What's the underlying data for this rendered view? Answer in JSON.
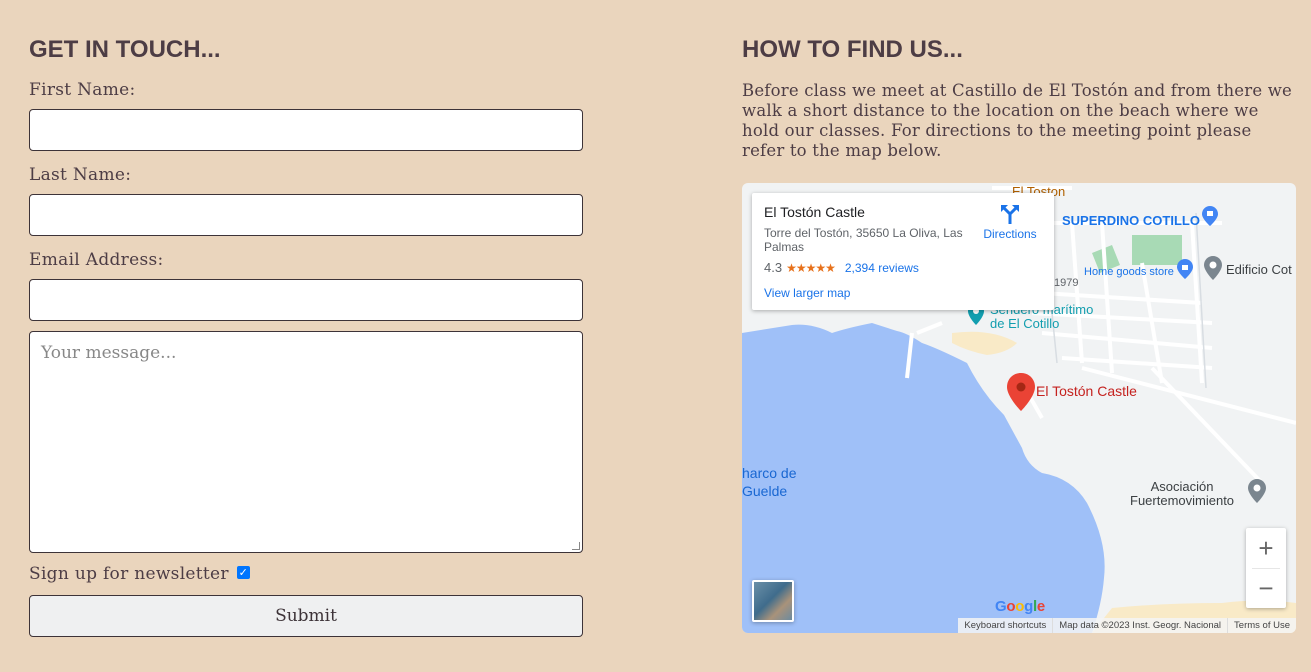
{
  "contact": {
    "heading": "GET IN TOUCH...",
    "first_name_label": "First Name:",
    "last_name_label": "Last Name:",
    "email_label": "Email Address:",
    "message_placeholder": "Your message...",
    "newsletter_label": "Sign up for newsletter",
    "newsletter_checked": true,
    "submit_label": "Submit"
  },
  "find_us": {
    "heading": "HOW TO FIND US...",
    "description": "Before class we meet at Castillo de El Tostón and from there we walk a short distance to the location on the beach where we hold our classes. For directions to the meeting point please refer to the map below."
  },
  "map": {
    "place_name": "El Tostón Castle",
    "address": "Torre del Tostón, 35650 La Oliva, Las Palmas",
    "rating": "4.3",
    "stars": "★★★★★",
    "reviews": "2,394 reviews",
    "view_larger": "View larger map",
    "directions": "Directions",
    "labels": {
      "el_toston": "El Toston",
      "superdino": "SUPERDINO COTILLO",
      "home_goods": "Home goods store",
      "edificio": "Edificio Cot",
      "year": "1979",
      "sendero_1": "Sendero marítimo",
      "sendero_2": "de El Cotillo",
      "castle_marker": "El Tostón Castle",
      "charco_1": "harco de",
      "charco_2": "Guelde",
      "asociacion_1": "Asociación",
      "asociacion_2": "Fuertemovimiento"
    },
    "zoom_in": "+",
    "zoom_out": "−",
    "google": "Google",
    "keyboard_shortcuts": "Keyboard shortcuts",
    "map_data": "Map data ©2023 Inst. Geogr. Nacional",
    "terms": "Terms of Use",
    "colors": {
      "water": "#9fc0f8",
      "land": "#f1f3f4",
      "park": "#a8dab5",
      "road": "#ffffff",
      "marker": "#ea4335",
      "poi_teal": "#129eaf",
      "poi_blue": "#1a73e8"
    }
  }
}
